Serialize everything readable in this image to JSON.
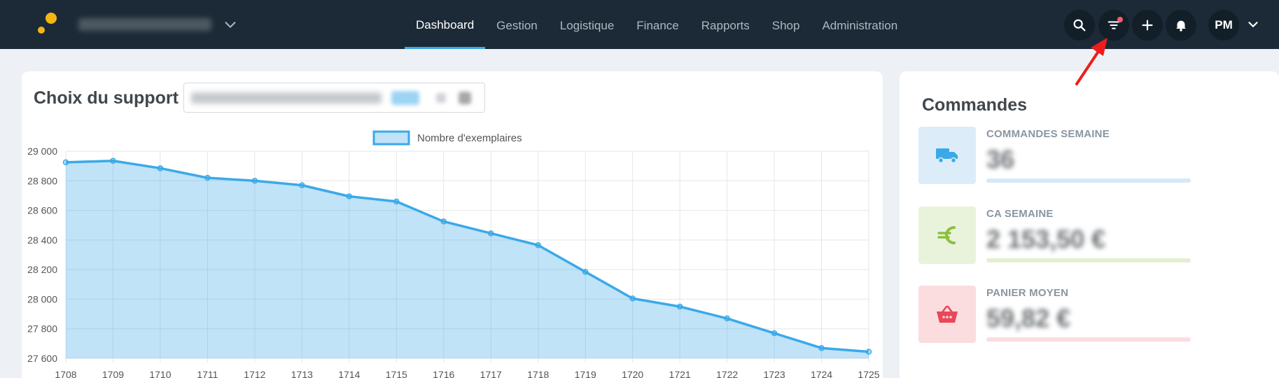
{
  "header": {
    "nav": [
      {
        "label": "Dashboard",
        "active": true
      },
      {
        "label": "Gestion",
        "active": false
      },
      {
        "label": "Logistique",
        "active": false
      },
      {
        "label": "Finance",
        "active": false
      },
      {
        "label": "Rapports",
        "active": false
      },
      {
        "label": "Shop",
        "active": false
      },
      {
        "label": "Administration",
        "active": false
      }
    ],
    "icons": [
      "search-icon",
      "filter-icon",
      "plus-icon",
      "bell-icon"
    ],
    "user_initials": "PM",
    "colors": {
      "bg": "#1b2a36",
      "accent": "#3ba9e8",
      "logo": "#f5b513",
      "notification": "#ff5a6b"
    }
  },
  "support_panel": {
    "title": "Choix du support"
  },
  "chart_data": {
    "type": "area",
    "series": [
      {
        "name": "Nombre d'exemplaires",
        "color": "#3ba9e8",
        "values": [
          28925,
          28935,
          28885,
          28820,
          28800,
          28770,
          28695,
          28660,
          28525,
          28445,
          28365,
          28185,
          28005,
          27950,
          27870,
          27770,
          27670,
          27645
        ]
      }
    ],
    "categories": [
      "1708",
      "1709",
      "1710",
      "1711",
      "1712",
      "1713",
      "1714",
      "1715",
      "1716",
      "1717",
      "1718",
      "1719",
      "1720",
      "1721",
      "1722",
      "1723",
      "1724",
      "1725"
    ],
    "y_ticks": [
      "29 000",
      "28 800",
      "28 600",
      "28 400",
      "28 200",
      "28 000",
      "27 800",
      "27 600"
    ],
    "ylim": [
      27600,
      29000
    ],
    "grid": true,
    "legend_position": "top"
  },
  "orders": {
    "title": "Commandes",
    "stats": [
      {
        "label": "COMMANDES SEMAINE",
        "value": "36",
        "icon": "truck-icon",
        "color": "#3ba9e8",
        "bg": "#dcedf9",
        "bar": "#d4e9f8"
      },
      {
        "label": "CA SEMAINE",
        "value": "2 153,50 €",
        "icon": "euro-icon",
        "color": "#8cbf3f",
        "bg": "#e9f3dc",
        "bar": "#e4efd2"
      },
      {
        "label": "PANIER MOYEN",
        "value": "59,82 €",
        "icon": "basket-icon",
        "color": "#e8485a",
        "bg": "#fbdde0",
        "bar": "#fbdde0"
      }
    ]
  }
}
